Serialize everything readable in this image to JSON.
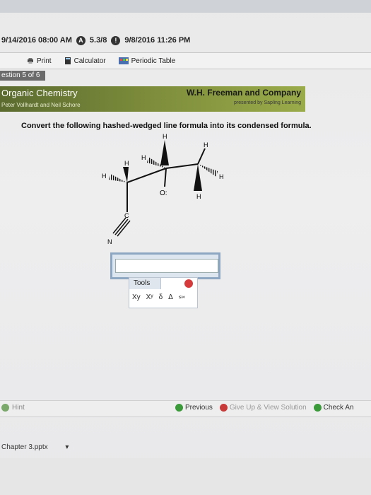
{
  "browser": {
    "dates": {
      "left_date": "9/14/2016 08:00 AM",
      "badge_text": "5.3/8",
      "right_date": "9/8/2016 11:26 PM"
    },
    "toolbar": {
      "print": "Print",
      "calculator": "Calculator",
      "periodic_table": "Periodic Table"
    },
    "question_counter": "estion 5 of 6"
  },
  "banner": {
    "title": "Organic Chemistry",
    "subtitle": "Peter Vollhardt and Neil Schore",
    "publisher": "W.H. Freeman and Company",
    "presenter": "presented by Sapling Learning"
  },
  "question_text": "Convert the following hashed-wedged line formula into its condensed formula.",
  "molecule": {
    "atoms": {
      "h_top": "H",
      "h_right_top": "H",
      "h_right_mid": "H",
      "h_left_mid": "H",
      "h_left2": "H",
      "o": "O:",
      "h_bottom": "H",
      "c": "C",
      "n": "N"
    }
  },
  "answer_input": {
    "value": ""
  },
  "tools_panel": {
    "tab_label": "Tools",
    "symbols": [
      "Xy",
      "Xʸ",
      "δ",
      "Δ",
      "≤∞"
    ]
  },
  "bottom": {
    "hint": "Hint",
    "previous": "Previous",
    "give_up": "Give Up & View Solution",
    "check": "Check An"
  },
  "chapter_file": "Chapter 3.pptx",
  "colors": {
    "banner_dark": "#5b6b2f",
    "banner_light": "#9aab4a",
    "input_border": "#8da7c2",
    "previous_green": "#3a9a3a",
    "giveup_red": "#c83a3a"
  }
}
